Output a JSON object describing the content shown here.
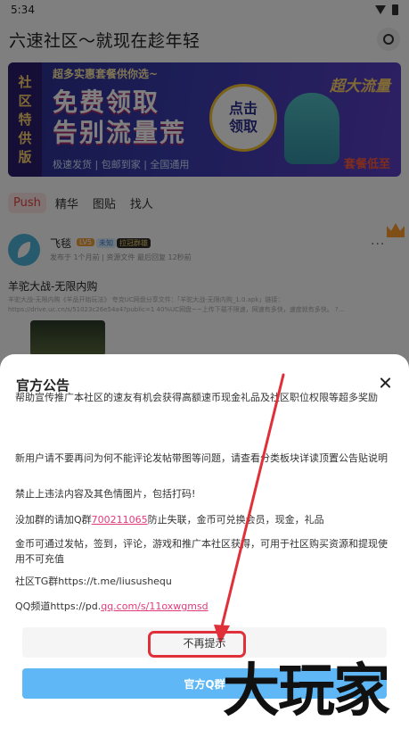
{
  "status_bar": {
    "time": "5:34"
  },
  "header": {
    "title": "六速社区～就现在趁年轻"
  },
  "banner": {
    "side_chars": [
      "社",
      "区",
      "特",
      "供",
      "版"
    ],
    "top_text": "超多实惠套餐供你选~",
    "main_line1": "免费领取",
    "main_line2": "告别流量荒",
    "badge_line1": "点击",
    "badge_line2": "领取",
    "right_text": "超大流量",
    "corner_text": "套餐低至",
    "footer_text": "极速发货 | 包邮到家 | 全国通用"
  },
  "tabs": [
    {
      "label": "Push",
      "active": true
    },
    {
      "label": "精华",
      "active": false
    },
    {
      "label": "图贴",
      "active": false
    },
    {
      "label": "找人",
      "active": false
    }
  ],
  "post": {
    "author": "飞毯",
    "level": "LV5",
    "badge_unknown": "未知",
    "badge_group": "拉冠群雄",
    "meta": "发布于 1个月前 | 资源文件 最后回复 12秒前",
    "title": "羊驼大战-无限内购",
    "excerpt": "羊驼大战-无限内购《羊品开始玩法》 夸克UC网盘分享文件：「羊驼大战-无限内购_1.0.apk」链接：https://drive.uc.cn/s/51023c26e54a4?public=1 40%UC网盘~~上传下载不限速，网速有多快，速度就有多快。 ?..."
  },
  "dialog": {
    "title": "官方公告",
    "p1": "帮助宣传推广本社区的速友有机会获得高额速币现金礼品及社区职位权限等超多奖励",
    "p2": "新用户请不要再问为何不能评论发帖带图等问题，请查看分类板块详读顶置公告贴说明",
    "p3": "禁止上违法内容及其色情图片，包括打码!",
    "p4_before": "没加群的请加Q群",
    "p4_link": "700211065",
    "p4_after": "防止失联，金币可兑换会员，现金，礼品",
    "p5": "金币可通过发帖，签到，评论，游戏和推广本社区获得，可用于社区购买资源和提现使用不可充值",
    "p6": "社区TG群https://t.me/liusushequ",
    "p7_before": "QQ频道https://pd.",
    "p7_link": "qq.com/s/11oxwgmsd",
    "dismiss_label": "不再提示",
    "group_label": "官方Q群"
  },
  "watermark": {
    "text": "大玩家"
  },
  "colors": {
    "accent_red": "#e0303a",
    "tab_active": "#e0463f",
    "link": "#e03a7a",
    "group_button": "#5fb8f5"
  }
}
